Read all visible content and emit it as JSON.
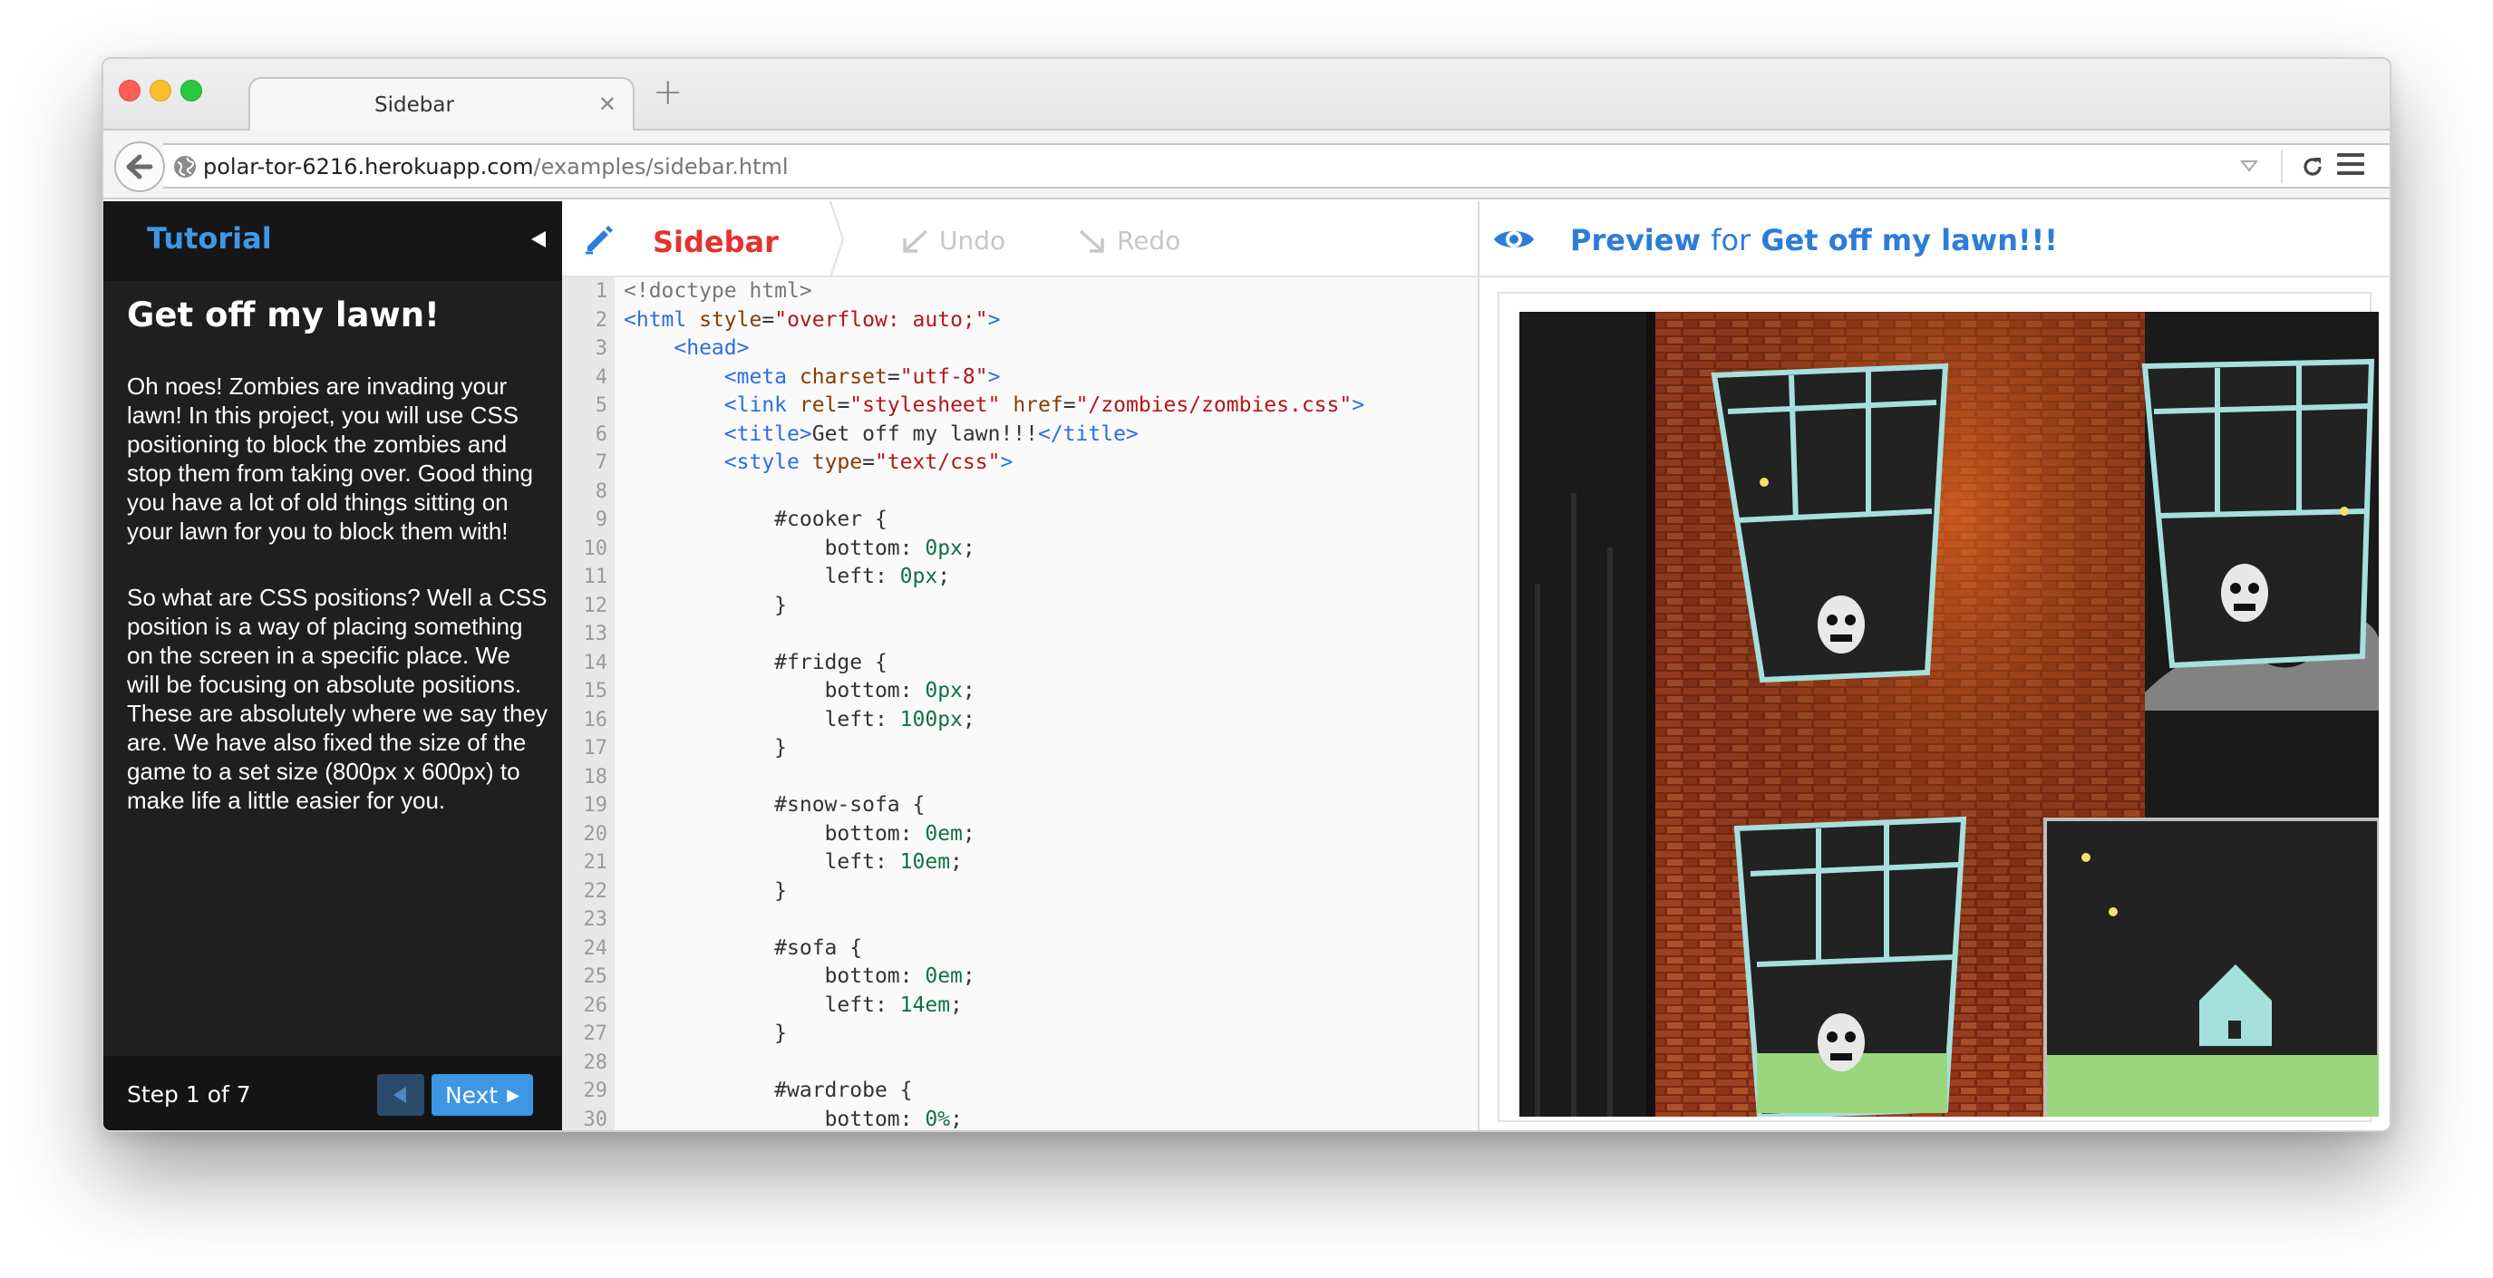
{
  "browser": {
    "tab_title": "Sidebar",
    "tab_close": "✕",
    "new_tab": "+",
    "url_host": "polar-tor-6216.herokuapp.com",
    "url_path": "/examples/sidebar.html"
  },
  "tutorial": {
    "header": "Tutorial",
    "title": "Get off my lawn!",
    "paragraphs": [
      "Oh noes! Zombies are invading your lawn! In this project, you will use CSS positioning to block the zombies and stop them from taking over. Good thing you have a lot of old things sitting on your lawn for you to block them with!",
      "So what are CSS positions? Well a CSS position is a way of placing something on the screen in a specific place. We will be focusing on absolute positions. These are absolutely where we say they are. We have also fixed the size of the game to a set size (800px x 600px) to make life a little easier for you."
    ],
    "step": "Step 1 of 7",
    "prev": "◀",
    "next": "Next",
    "next_arrow": "▶"
  },
  "editor": {
    "file_name": "Sidebar",
    "undo": "Undo",
    "redo": "Redo",
    "line_numbers": [
      "1",
      "2",
      "3",
      "4",
      "5",
      "6",
      "7",
      "8",
      "9",
      "10",
      "11",
      "12",
      "13",
      "14",
      "15",
      "16",
      "17",
      "18",
      "19",
      "20",
      "21",
      "22",
      "23",
      "24",
      "25",
      "26",
      "27",
      "28",
      "29",
      "30"
    ],
    "lines": [
      "<!doctype html>",
      "<html style=\"overflow: auto;\">",
      "    <head>",
      "        <meta charset=\"utf-8\">",
      "        <link rel=\"stylesheet\" href=\"/zombies/zombies.css\">",
      "        <title>Get off my lawn!!!</title>",
      "        <style type=\"text/css\">",
      "",
      "            #cooker {",
      "                bottom: 0px;",
      "                left: 0px;",
      "            }",
      "",
      "            #fridge {",
      "                bottom: 0px;",
      "                left: 100px;",
      "            }",
      "",
      "            #snow-sofa {",
      "                bottom: 0em;",
      "                left: 10em;",
      "            }",
      "",
      "            #sofa {",
      "                bottom: 0em;",
      "                left: 14em;",
      "            }",
      "",
      "            #wardrobe {",
      "                bottom: 0%;"
    ]
  },
  "preview": {
    "label": "Preview",
    "for": "for",
    "title": "Get off my lawn!!!"
  },
  "colors": {
    "accent_blue": "#3d97e5",
    "file_red": "#e2332f",
    "tutorial_bg": "#1f1f1f"
  },
  "icons": {
    "back": "back-arrow-icon",
    "globe": "globe-icon",
    "reload": "reload-icon",
    "menu": "hamburger-menu-icon",
    "pencil": "pencil-icon",
    "eye": "eye-icon",
    "collapse": "collapse-triangle-icon"
  }
}
